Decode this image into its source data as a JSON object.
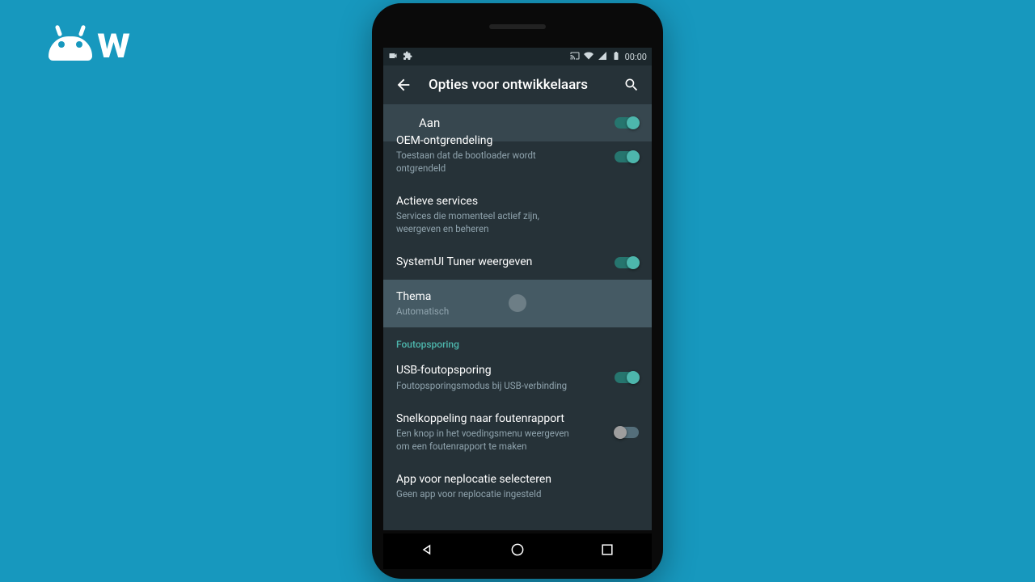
{
  "statusbar": {
    "time": "00:00"
  },
  "appbar": {
    "title": "Opties voor ontwikkelaars"
  },
  "master": {
    "label": "Aan",
    "on": true
  },
  "rows": [
    {
      "title": "OEM-ontgrendeling",
      "sub": "Toestaan dat de bootloader wordt ontgrendeld",
      "switch": true,
      "on": true
    },
    {
      "title": "Actieve services",
      "sub": "Services die momenteel actief zijn, weergeven en beheren"
    },
    {
      "title": "SystemUI Tuner weergeven",
      "switch": true,
      "on": true
    },
    {
      "title": "Thema",
      "sub": "Automatisch",
      "pressed": true
    }
  ],
  "section1": "Foutopsporing",
  "rows2": [
    {
      "title": "USB-foutopsporing",
      "sub": "Foutopsporingsmodus bij USB-verbinding",
      "switch": true,
      "on": true
    },
    {
      "title": "Snelkoppeling naar foutenrapport",
      "sub": "Een knop in het voedingsmenu weergeven om een foutenrapport te maken",
      "switch": true,
      "on": false
    },
    {
      "title": "App voor neplocatie selecteren",
      "sub": "Geen app voor neplocatie ingesteld"
    }
  ],
  "colors": {
    "accent": "#4db6ac",
    "bg": "#263238"
  }
}
